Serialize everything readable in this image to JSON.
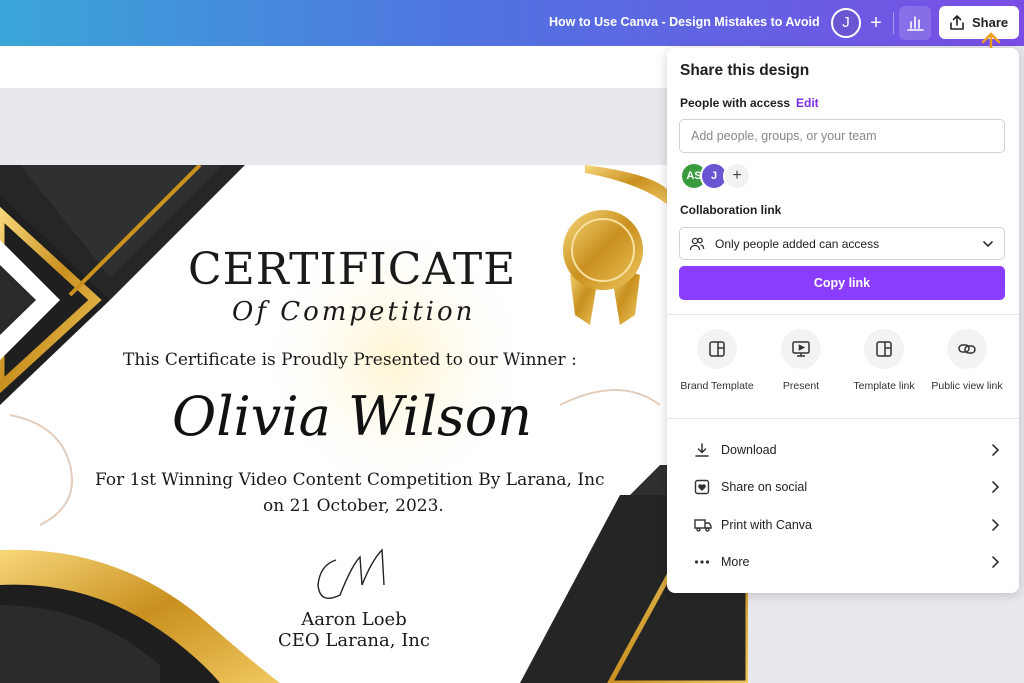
{
  "topbar": {
    "doc_title": "How to Use Canva - Design Mistakes to Avoid",
    "avatar_initial": "J",
    "add_label": "+",
    "share_label": "Share"
  },
  "certificate": {
    "title": "CERTIFICATE",
    "subtitle": "Of Competition",
    "presented": "This Certificate is Proudly Presented to our Winner :",
    "winner": "Olivia Wilson",
    "for_line": "For 1st Winning Video Content Competition By Larana, Inc",
    "date_line": "on 21 October, 2023.",
    "signer": "Aaron Loeb",
    "signer_title": "CEO Larana, Inc"
  },
  "share_panel": {
    "title": "Share this design",
    "people_label": "People with access",
    "edit_label": "Edit",
    "input_placeholder": "Add people, groups, or your team",
    "avatars": [
      "AS",
      "J"
    ],
    "avatar_add": "+",
    "collab_label": "Collaboration link",
    "access_option": "Only people added can access",
    "copy_label": "Copy link",
    "options": [
      {
        "label": "Brand Template",
        "icon": "template-icon"
      },
      {
        "label": "Present",
        "icon": "present-icon"
      },
      {
        "label": "Template link",
        "icon": "template-link-icon"
      },
      {
        "label": "Public view link",
        "icon": "link-icon"
      }
    ],
    "actions": [
      {
        "label": "Download",
        "icon": "download-icon"
      },
      {
        "label": "Share on social",
        "icon": "heart-icon"
      },
      {
        "label": "Print with Canva",
        "icon": "truck-icon"
      },
      {
        "label": "More",
        "icon": "more-icon"
      }
    ]
  },
  "colors": {
    "accent": "#8b3dff",
    "edit_link": "#7d2ae8",
    "arrow": "#f0a020"
  }
}
